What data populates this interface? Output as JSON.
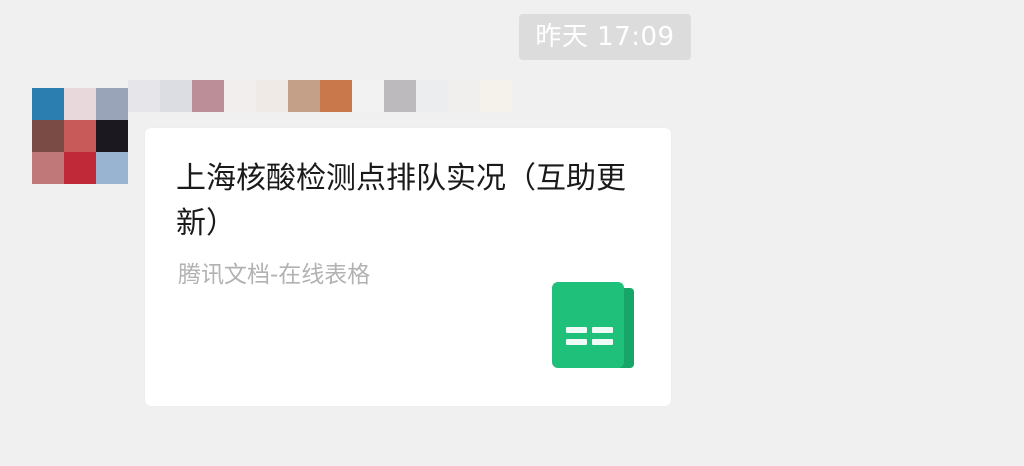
{
  "timestamp": "昨天 17:09",
  "sender": {
    "avatar": "obscured-avatar",
    "name": ""
  },
  "card": {
    "title": "上海核酸检测点排队实况（互助更新）",
    "source": "腾讯文档-在线表格",
    "icon": "spreadsheet-icon"
  },
  "colors": {
    "background": "#f0f0f0",
    "timestamp_bg": "#dcdcdc",
    "card_bg": "#ffffff",
    "title_text": "#1a1a1a",
    "subtitle_text": "#b2b2b2",
    "sheet_icon_green": "#1ec07a",
    "sheet_icon_dark": "#17a568"
  }
}
